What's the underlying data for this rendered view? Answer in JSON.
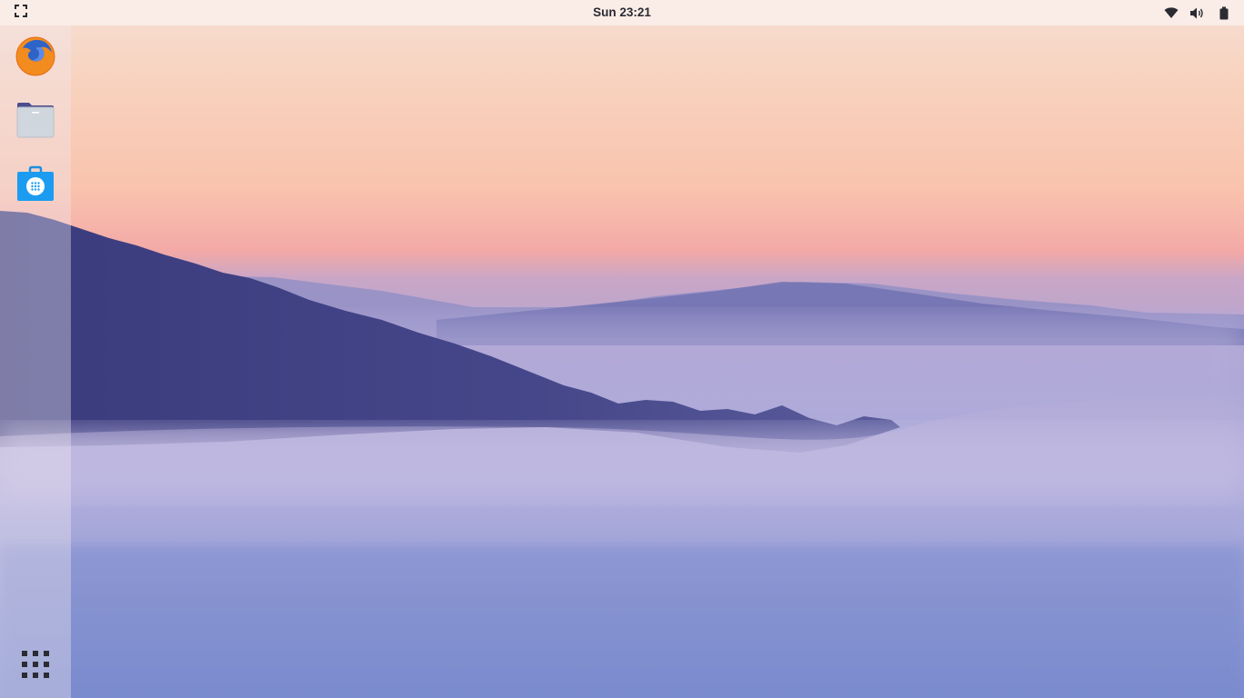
{
  "top_bar": {
    "clock": "Sun 23:21",
    "icons": {
      "activities": "screen-corners-icon",
      "network": "wifi-icon",
      "volume": "speaker-icon",
      "battery": "battery-icon"
    }
  },
  "dock": {
    "items": [
      {
        "app": "firefox",
        "icon": "firefox-icon"
      },
      {
        "app": "files",
        "icon": "files-icon"
      },
      {
        "app": "software",
        "icon": "software-store-icon"
      }
    ],
    "show_apps_icon": "app-grid-icon"
  },
  "colors": {
    "top_bar_bg": "#faeee8",
    "text": "#2b2b33",
    "sky_top": "#f6dfd3",
    "sky_pink": "#f3a9a7",
    "fog": "#a6a6d8",
    "hill": "#3c3d80"
  }
}
